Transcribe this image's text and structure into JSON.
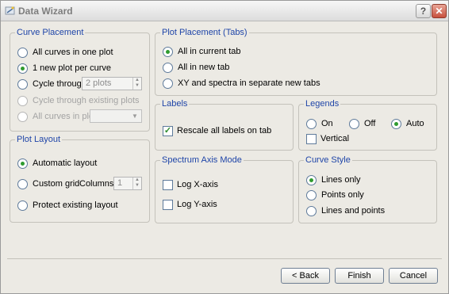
{
  "window": {
    "title": "Data Wizard",
    "help_glyph": "?",
    "close_glyph": "✕"
  },
  "curve_placement": {
    "legend": "Curve Placement",
    "all_in_one": "All curves in one plot",
    "one_per_curve": "1 new plot per curve",
    "cycle_through": "Cycle through",
    "cycle_value": "2 plots",
    "cycle_existing": "Cycle through existing plots",
    "all_in_plot": "All curves in plot",
    "selected": "1 new plot per curve"
  },
  "plot_layout": {
    "legend": "Plot Layout",
    "automatic": "Automatic layout",
    "custom_grid": "Custom grid",
    "columns_label": "Columns:",
    "columns_value": "1",
    "protect": "Protect existing layout",
    "selected": "Automatic layout"
  },
  "plot_placement": {
    "legend": "Plot Placement (Tabs)",
    "current_tab": "All in current tab",
    "new_tab": "All in new tab",
    "separate": "XY and spectra in separate new tabs",
    "selected": "All in current tab"
  },
  "labels": {
    "legend": "Labels",
    "rescale": "Rescale all labels on tab",
    "rescale_checked": true
  },
  "legends": {
    "legend": "Legends",
    "on": "On",
    "off": "Off",
    "auto": "Auto",
    "selected": "Auto",
    "vertical": "Vertical",
    "vertical_checked": false
  },
  "spectrum_axis": {
    "legend": "Spectrum Axis Mode",
    "log_x": "Log X-axis",
    "log_y": "Log Y-axis",
    "log_x_checked": false,
    "log_y_checked": false
  },
  "curve_style": {
    "legend": "Curve Style",
    "lines_only": "Lines only",
    "points_only": "Points only",
    "lines_points": "Lines and points",
    "selected": "Lines only"
  },
  "buttons": {
    "back": "< Back",
    "finish": "Finish",
    "cancel": "Cancel"
  },
  "colors": {
    "accent_text": "#1f45a8",
    "radio_dot": "#2f9b2f",
    "background": "#eceae4"
  },
  "icons": {
    "app": "wand-icon",
    "help": "help-icon",
    "close": "close-icon",
    "check": "checkmark-icon",
    "spin_arrows": "spin-arrows-icon",
    "dropdown": "chevron-down-icon"
  }
}
